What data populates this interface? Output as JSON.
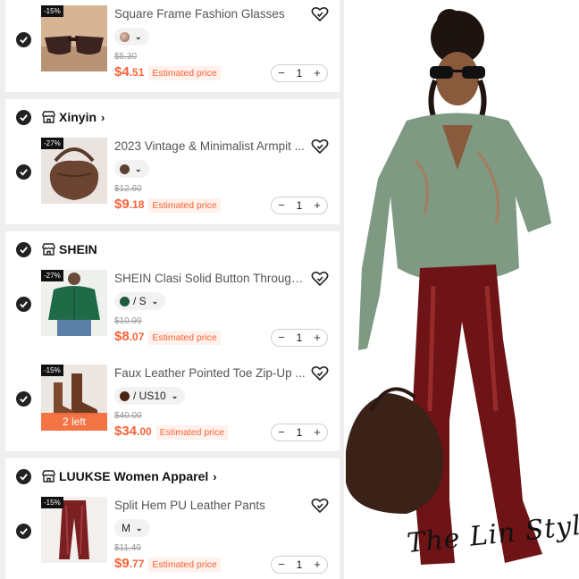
{
  "cart": {
    "stores": [
      {
        "name": "",
        "items": [
          {
            "title": "Square Frame Fashion Glasses",
            "discount": "-15%",
            "variant": "",
            "swatch_color": "#a57868",
            "old_price": "$5.30",
            "price_main": "$4",
            "price_cents": ".51",
            "estimated_label": "Estimated price",
            "qty": "1",
            "stock_badge": ""
          }
        ]
      },
      {
        "name": "Xinyin",
        "items": [
          {
            "title": "2023 Vintage & Minimalist Armpit ...",
            "discount": "-27%",
            "variant": "",
            "swatch_color": "#5b4034",
            "old_price": "$12.60",
            "price_main": "$9",
            "price_cents": ".18",
            "estimated_label": "Estimated price",
            "qty": "1",
            "stock_badge": ""
          }
        ]
      },
      {
        "name": "SHEIN",
        "items": [
          {
            "title": "SHEIN Clasi Solid Button Through ...",
            "discount": "-27%",
            "variant": "/ S",
            "swatch_color": "#1e5a3e",
            "old_price": "$10.99",
            "price_main": "$8",
            "price_cents": ".07",
            "estimated_label": "Estimated price",
            "qty": "1",
            "stock_badge": ""
          },
          {
            "title": "Faux Leather Pointed Toe Zip-Up ...",
            "discount": "-15%",
            "variant": "/ US10",
            "swatch_color": "#4a2515",
            "old_price": "$40.00",
            "price_main": "$34",
            "price_cents": ".00",
            "estimated_label": "Estimated price",
            "qty": "1",
            "stock_badge": "2 left"
          }
        ]
      },
      {
        "name": "LUUKSE Women Apparel",
        "items": [
          {
            "title": "Split Hem PU Leather Pants",
            "discount": "-15%",
            "variant": "M",
            "swatch_color": "",
            "old_price": "$11.49",
            "price_main": "$9",
            "price_cents": ".77",
            "estimated_label": "Estimated price",
            "qty": "1",
            "stock_badge": ""
          }
        ]
      }
    ],
    "stepper": {
      "minus": "−",
      "plus": "+"
    }
  },
  "photo": {
    "watermark": "The Lin Style"
  },
  "colors": {
    "accent": "#fa6338",
    "check": "#222222",
    "background": "#eeeeee"
  },
  "icons": [
    "check-icon",
    "store-icon",
    "chevron-right-icon",
    "wishlist-icon",
    "chevron-down-icon"
  ]
}
